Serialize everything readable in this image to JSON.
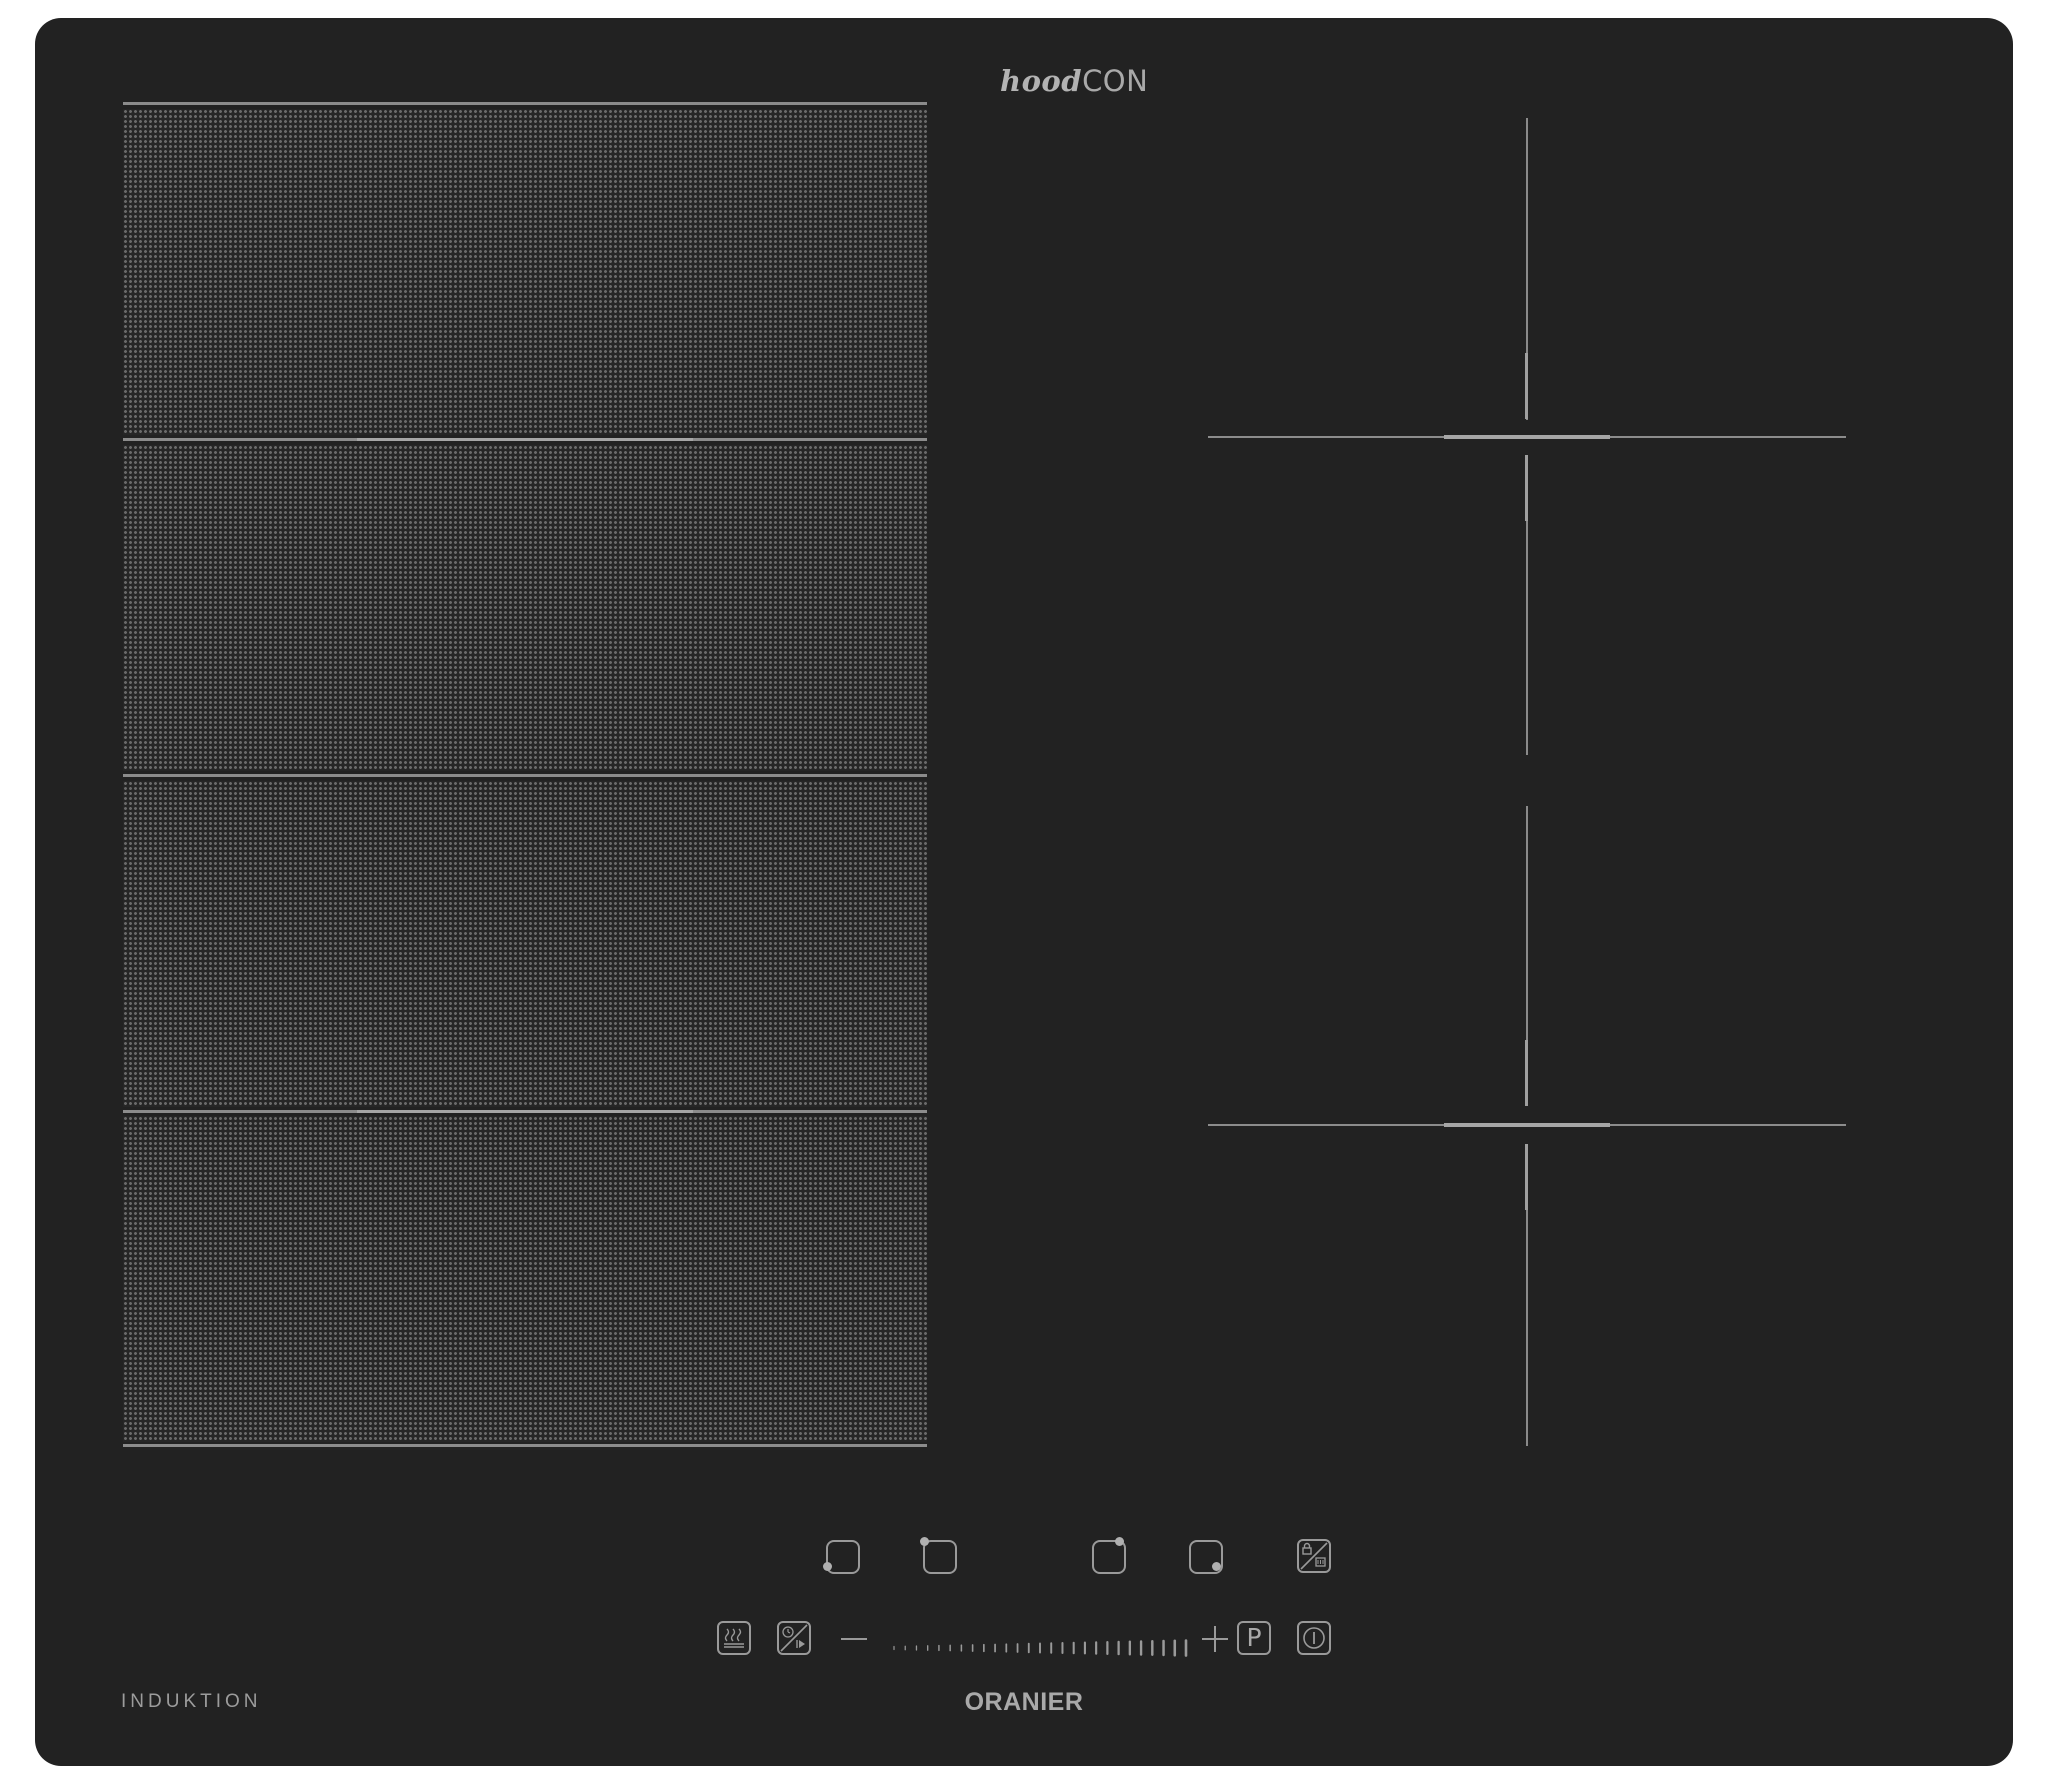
{
  "brand_logo": {
    "prefix": "hood",
    "suffix": "CON"
  },
  "cooking_zones": {
    "left": {
      "type": "flex-induction",
      "sections": 4
    },
    "right": {
      "type": "induction",
      "zones": 4
    }
  },
  "controls": {
    "zone_selectors": [
      {
        "name": "front-left",
        "icon": "zone-front-left-icon"
      },
      {
        "name": "rear-left",
        "icon": "zone-rear-left-icon"
      },
      {
        "name": "rear-right",
        "icon": "zone-rear-right-icon"
      },
      {
        "name": "front-right",
        "icon": "zone-front-right-icon"
      }
    ],
    "lock_icon": "child-lock-clean-lock-icon",
    "keep_warm_icon": "keep-warm-icon",
    "timer_icon": "timer-pause-icon",
    "minus_icon": "minus-icon",
    "plus_icon": "plus-icon",
    "power_boost_label": "P",
    "power_icon": "power-on-off-icon",
    "slider_steps": 27
  },
  "label_type": "INDUKTION",
  "label_brand": "ORANIER",
  "colors": {
    "glass": "#222222",
    "markings": "#9a9a9a",
    "background": "#ffffff"
  }
}
